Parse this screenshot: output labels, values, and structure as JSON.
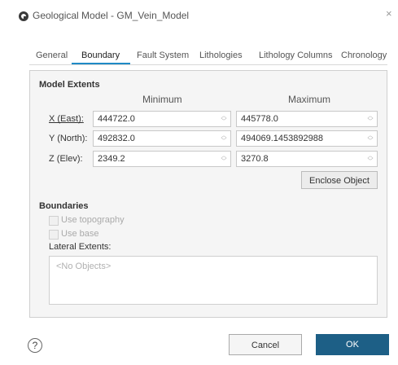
{
  "window": {
    "title": "Geological Model - GM_Vein_Model",
    "close_label": "×"
  },
  "tabs": [
    {
      "label": "General"
    },
    {
      "label": "Boundary",
      "active": true
    },
    {
      "label": "Fault System"
    },
    {
      "label": "Lithologies"
    },
    {
      "label": "Lithology Columns"
    },
    {
      "label": "Chronology"
    }
  ],
  "model_extents": {
    "title": "Model Extents",
    "col_min": "Minimum",
    "col_max": "Maximum",
    "rows": [
      {
        "label": "X (East):",
        "min": "444722.0",
        "max": "445778.0"
      },
      {
        "label": "Y (North):",
        "min": "492832.0",
        "max": "494069.1453892988"
      },
      {
        "label": "Z (Elev):",
        "min": "2349.2",
        "max": "3270.8"
      }
    ],
    "enclose_label": "Enclose Object"
  },
  "boundaries": {
    "title": "Boundaries",
    "use_topography": "Use topography",
    "use_base": "Use base",
    "lateral_extents": "Lateral Extents:",
    "list_placeholder": "<No Objects>"
  },
  "footer": {
    "help_label": "?",
    "cancel_label": "Cancel",
    "ok_label": "OK"
  },
  "colors": {
    "accent": "#1f8ac6",
    "ok_button": "#1d5f86",
    "panel_bg": "#f5f5f5"
  }
}
